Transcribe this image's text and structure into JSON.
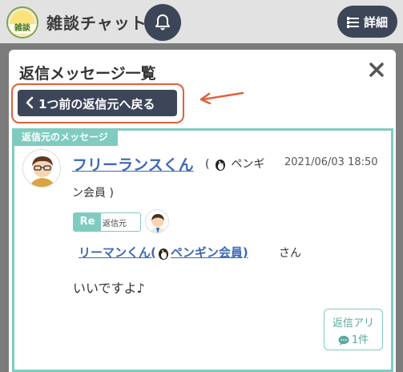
{
  "header": {
    "logo_text": "雑談",
    "app_title": "雑談チャット",
    "detail_label": "詳細",
    "icons": {
      "bell": "bell-icon",
      "list": "list-icon"
    }
  },
  "modal": {
    "title": "返信メッセージ一覧",
    "back_button_label": "1つ前の返信元へ戻る",
    "source_tag": "返信元のメッセージ",
    "message": {
      "author_name": "フリーランスくん",
      "author_badge_prefix": "(",
      "author_badge_text": "ペンギ",
      "author_badge_cont": "ン会員 )",
      "timestamp": "2021/06/03 18:50",
      "re_label": "Re",
      "re_sub": "返信元",
      "mention_name_a": "リーマンくん(",
      "mention_name_b": "ペンギン会員)",
      "mention_suffix": "さん",
      "body": "いいですよ♪",
      "reply_badge_line1": "返信アリ",
      "reply_badge_count": "1件"
    }
  },
  "colors": {
    "navy": "#3c4658",
    "teal": "#80cbc0",
    "link_blue": "#3d69b3",
    "highlight_orange": "#e0603a"
  }
}
